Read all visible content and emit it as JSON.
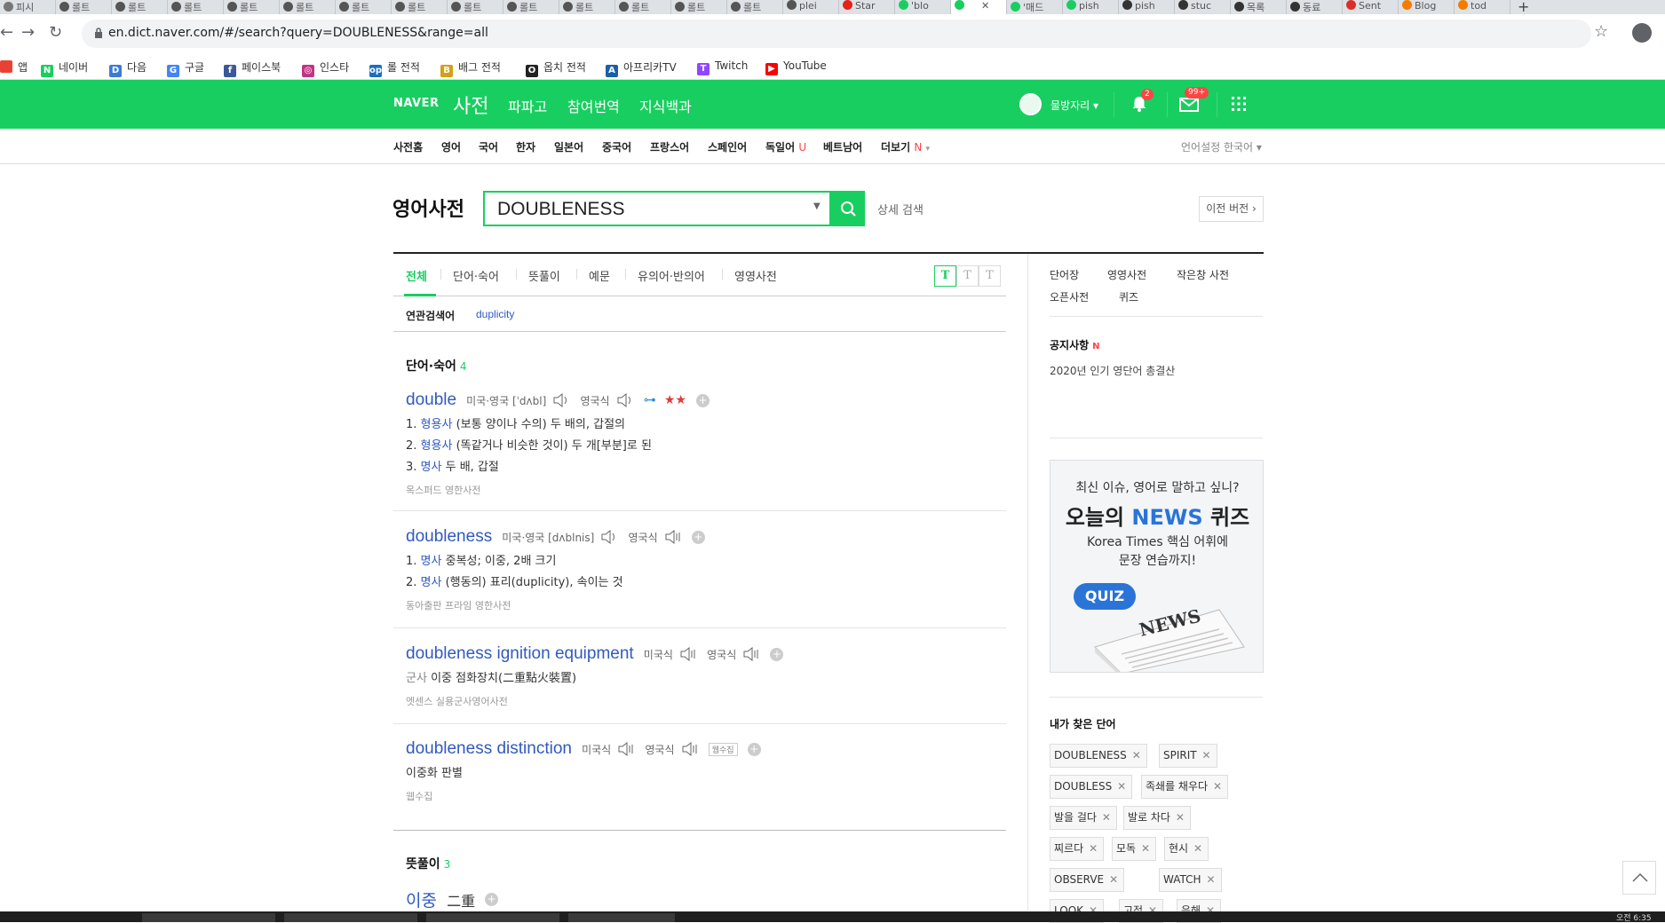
{
  "browser": {
    "tabs": [
      {
        "label": "피시",
        "color": "#777"
      },
      {
        "label": "롤트",
        "color": "#555"
      },
      {
        "label": "롤트",
        "color": "#555"
      },
      {
        "label": "롤트",
        "color": "#555"
      },
      {
        "label": "롤트",
        "color": "#555"
      },
      {
        "label": "롤트",
        "color": "#555"
      },
      {
        "label": "롤트",
        "color": "#555"
      },
      {
        "label": "롤트",
        "color": "#555"
      },
      {
        "label": "롤트",
        "color": "#555"
      },
      {
        "label": "롤트",
        "color": "#555"
      },
      {
        "label": "롤트",
        "color": "#555"
      },
      {
        "label": "롤트",
        "color": "#555"
      },
      {
        "label": "롤트",
        "color": "#555"
      },
      {
        "label": "롤트",
        "color": "#555"
      },
      {
        "label": "plei",
        "color": "#555"
      },
      {
        "label": "Star",
        "color": "#e62117"
      },
      {
        "label": "'blo",
        "color": "#19ce60"
      },
      {
        "label": "",
        "color": "#19ce60",
        "active": true
      },
      {
        "label": "'매드",
        "color": "#19ce60"
      },
      {
        "label": "pish",
        "color": "#19ce60"
      },
      {
        "label": "pish",
        "color": "#333"
      },
      {
        "label": "stuc",
        "color": "#333"
      },
      {
        "label": "목록",
        "color": "#333"
      },
      {
        "label": "동료",
        "color": "#333"
      },
      {
        "label": "Sent",
        "color": "#d93025"
      },
      {
        "label": "Blog",
        "color": "#f57c00"
      },
      {
        "label": "tod",
        "color": "#f57c00"
      }
    ],
    "url": "en.dict.naver.com/#/search?query=DOUBLENESS&range=all",
    "bookmarks": [
      {
        "label": "앱",
        "color": "#e94235",
        "icon": "apps-grid-icon",
        "glyph": ""
      },
      {
        "label": "네이버",
        "color": "#19ce60",
        "icon": "naver-icon",
        "glyph": "N"
      },
      {
        "label": "다음",
        "color": "#3a7bd5",
        "icon": "daum-icon",
        "glyph": "D"
      },
      {
        "label": "구글",
        "color": "#4285f4",
        "icon": "google-icon",
        "glyph": "G"
      },
      {
        "label": "페이스북",
        "color": "#3b5998",
        "icon": "facebook-icon",
        "glyph": "f"
      },
      {
        "label": "인스타",
        "color": "#c13584",
        "icon": "instagram-icon",
        "glyph": "◎"
      },
      {
        "label": "롤 전적",
        "color": "#1b6ec2",
        "icon": "opgg-icon",
        "glyph": "op"
      },
      {
        "label": "배그 전적",
        "color": "#d4a017",
        "icon": "pubg-icon",
        "glyph": "B"
      },
      {
        "label": "옵치 전적",
        "color": "#222222",
        "icon": "overwatch-icon",
        "glyph": "O"
      },
      {
        "label": "아프리카TV",
        "color": "#1a5fa8",
        "icon": "afreeca-icon",
        "glyph": "A"
      },
      {
        "label": "Twitch",
        "color": "#9146ff",
        "icon": "twitch-icon",
        "glyph": "T"
      },
      {
        "label": "YouTube",
        "color": "#ff0000",
        "icon": "youtube-icon",
        "glyph": "▶"
      }
    ]
  },
  "gnb": {
    "logo": "NAVER",
    "service": "사전",
    "menus": [
      "파파고",
      "참여번역",
      "지식백과"
    ],
    "user": "물방자리",
    "notif_badge": "2",
    "mail_badge": "99+"
  },
  "lnb": {
    "items": [
      "사전홈",
      "영어",
      "국어",
      "한자",
      "일본어",
      "중국어",
      "프랑스어",
      "스페인어",
      "독일어",
      "베트남어",
      "더보기"
    ],
    "more_badge": "N",
    "lang_setting": "언어설정 한국어"
  },
  "search": {
    "title": "영어사전",
    "query": "DOUBLENESS",
    "detail": "상세 검색",
    "prev_version": "이전 버전"
  },
  "tabs": {
    "items": [
      "전체",
      "단어·숙어",
      "뜻풀이",
      "예문",
      "유의어·반의어",
      "영영사전"
    ],
    "font_sizes": [
      "T",
      "T",
      "T"
    ]
  },
  "related": {
    "label": "연관검색어",
    "keyword": "duplicity"
  },
  "sections": {
    "word_idiom": {
      "title": "단어·숙어",
      "count": "4"
    },
    "meaning": {
      "title": "뜻풀이",
      "count": "3"
    }
  },
  "entries": [
    {
      "word": "double",
      "pron": "미국·영국 [ˈdʌbl]",
      "uk": "영국식",
      "stars": "★★",
      "meanings": [
        {
          "num": "1.",
          "pos": "형용사",
          "text": "(보통 양이나 수의) 두 배의, 갑절의"
        },
        {
          "num": "2.",
          "pos": "형용사",
          "text": "(똑같거나 비슷한 것이) 두 개[부분]로 된"
        },
        {
          "num": "3.",
          "pos": "명사",
          "text": "두 배, 갑절"
        }
      ],
      "source": "옥스퍼드 영한사전"
    },
    {
      "word": "doubleness",
      "pron": "미국·영국 [dʌblnis]",
      "uk": "영국식",
      "meanings": [
        {
          "num": "1.",
          "pos": "명사",
          "text": "중복성; 이중, 2배 크기"
        },
        {
          "num": "2.",
          "pos": "명사",
          "text": "(행동의) 표리(duplicity), 속이는 것"
        }
      ],
      "source": "동아출판 프라임 영한사전"
    },
    {
      "word_hl": "doubleness",
      "word_rest": " ignition equipment",
      "us": "미국식",
      "uk": "영국식",
      "meanings": [
        {
          "pos": "군사",
          "text": "이중 점화장치(二重點火裝置)"
        }
      ],
      "source": "엣센스 실용군사영어사전"
    },
    {
      "word_hl": "doubleness",
      "word_rest": " distinction",
      "us": "미국식",
      "uk": "영국식",
      "tag": "웹수집",
      "meanings": [
        {
          "text": "이중화 판별"
        }
      ],
      "source": "웹수집"
    },
    {
      "word": "이중",
      "hanja": "二重"
    }
  ],
  "sidebar": {
    "links": [
      "단어장",
      "영영사전",
      "작은창 사전",
      "오픈사전",
      "퀴즈"
    ],
    "notice_title": "공지사항",
    "notice_new": "N",
    "notice_item": "2020년 인기 영단어 총결산",
    "ad": {
      "line1": "최신 이슈, 영어로 말하고 싶니?",
      "line2a": "오늘의 ",
      "line2b": "NEWS",
      "line2c": " 퀴즈",
      "line3a": "Korea Times 핵심 어휘에",
      "line3b": "문장 연습까지!",
      "bubble": "QUIZ",
      "paper": "NEWS"
    },
    "history_title": "내가 찾은 단어",
    "history": [
      "DOUBLENESS",
      "SPIRIT",
      "DOUBLESS",
      "족쇄를 채우다",
      "발을 걸다",
      "발로 차다",
      "찌르다",
      "모독",
      "현시",
      "OBSERVE",
      "WATCH",
      "LOOK",
      "고정",
      "응해"
    ]
  },
  "taskbar": {
    "clock": "오전 6:35"
  }
}
